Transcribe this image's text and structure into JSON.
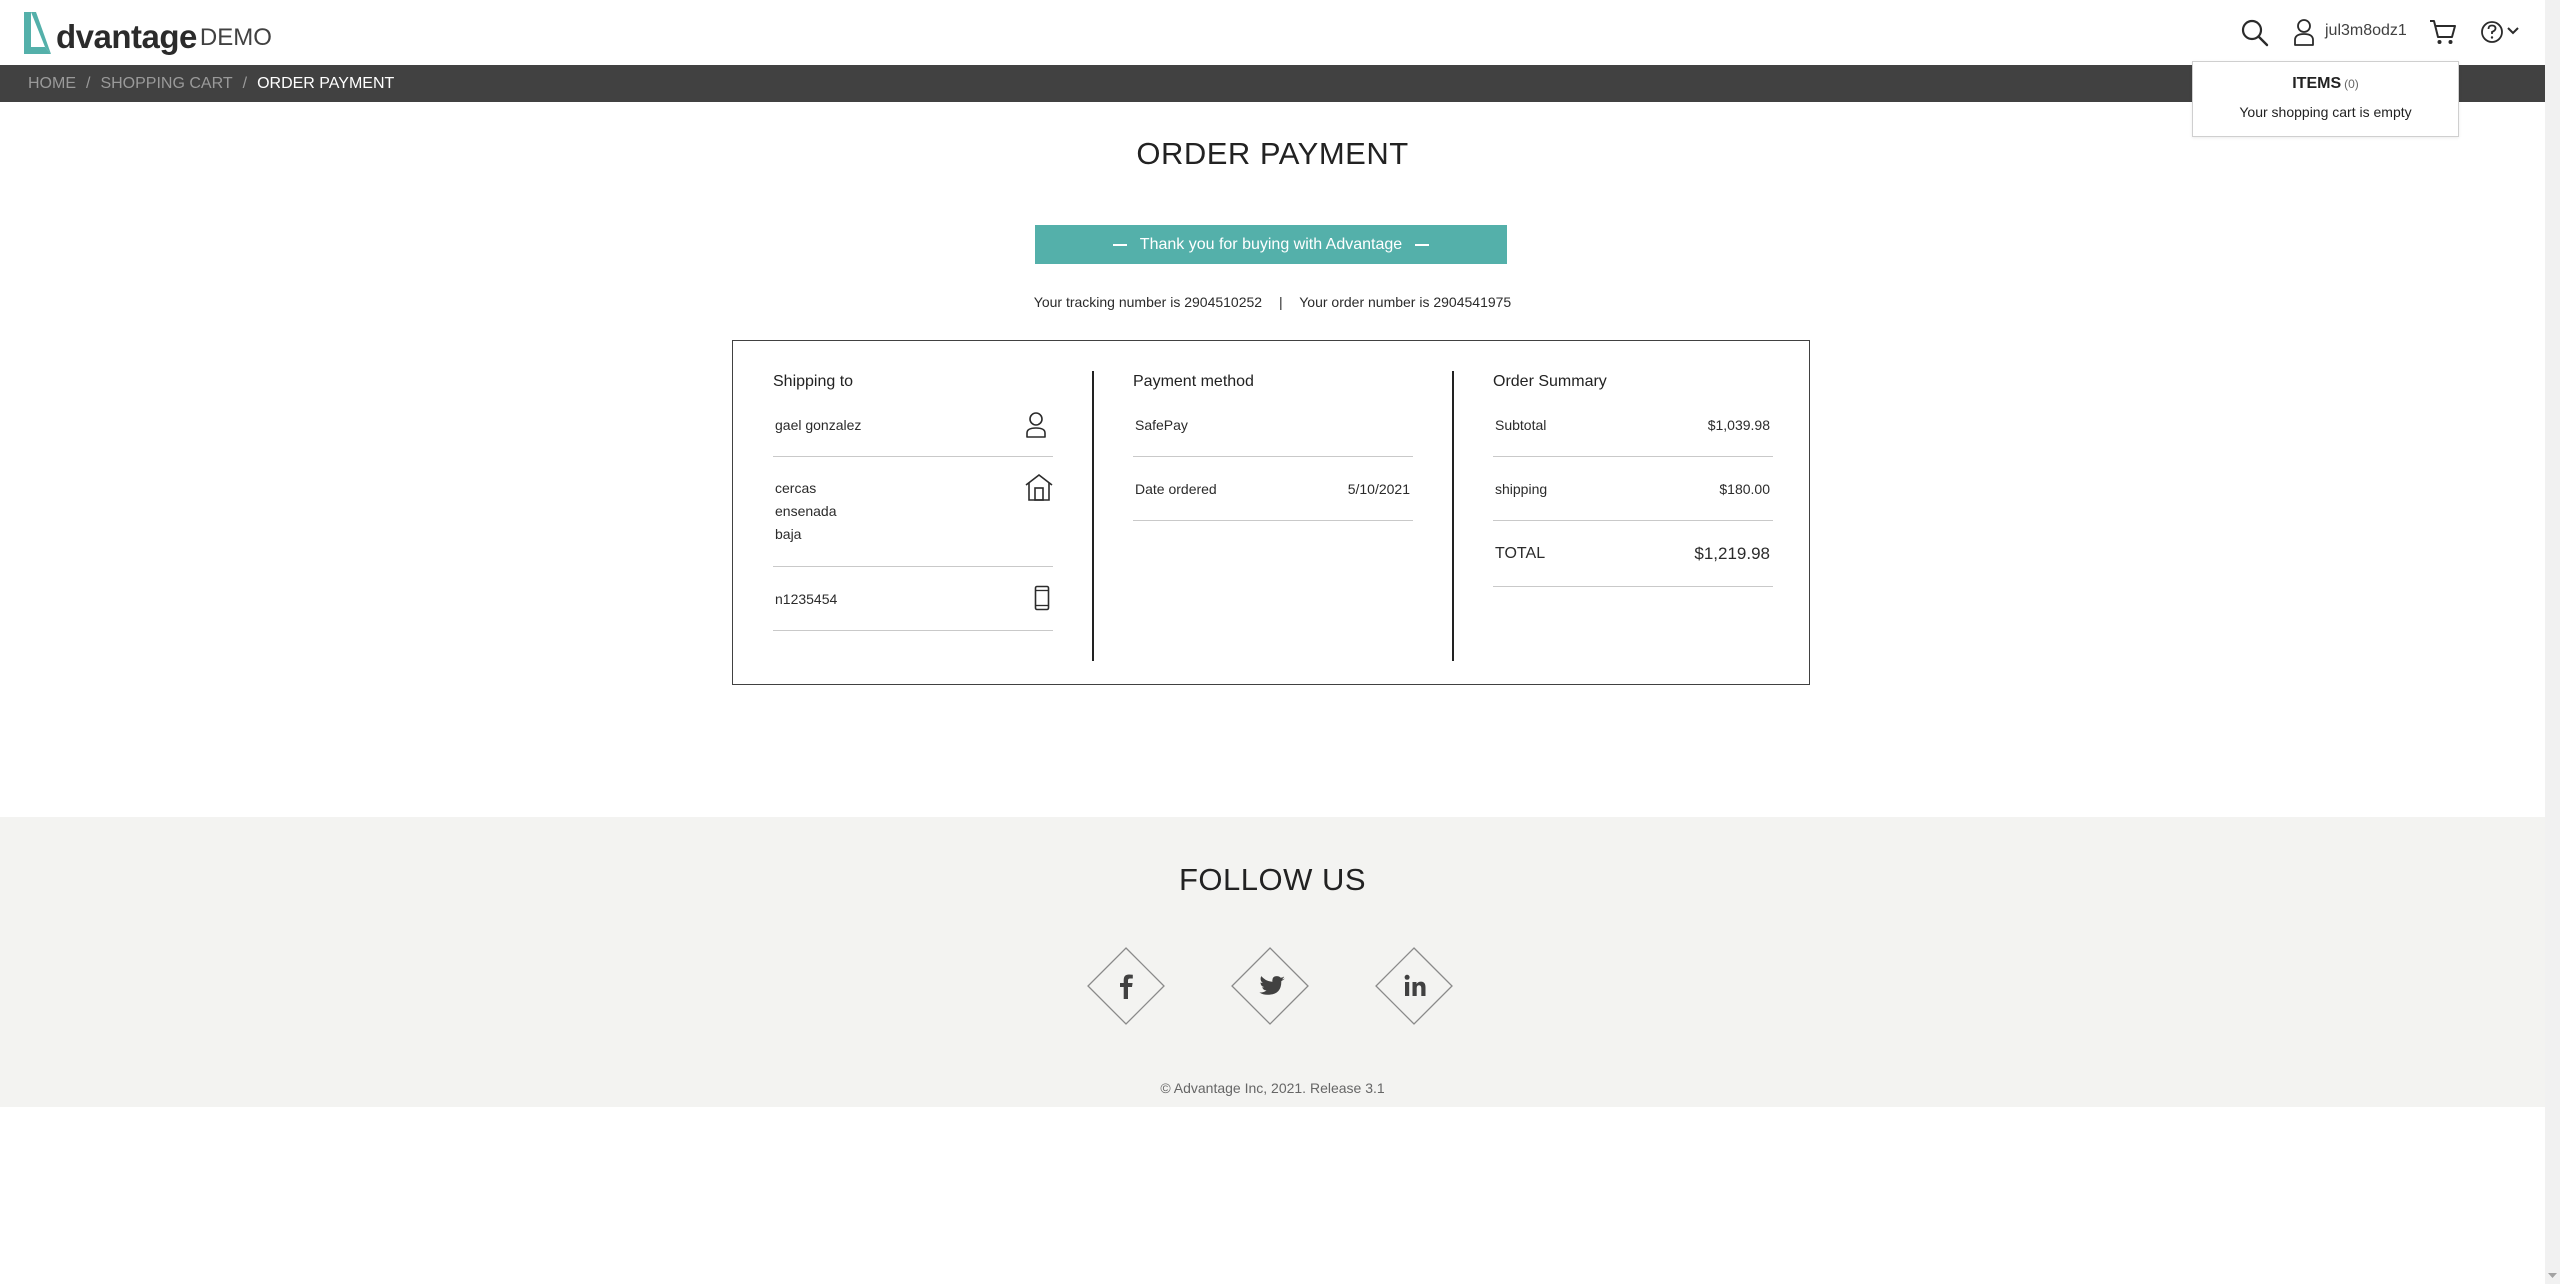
{
  "logo": {
    "word": "dvantage",
    "suffix": "DEMO"
  },
  "header": {
    "username": "jul3m8odz1"
  },
  "breadcrumb": {
    "home": "HOME",
    "cart": "SHOPPING CART",
    "current": "ORDER PAYMENT",
    "separator": "/"
  },
  "cart_dropdown": {
    "title": "ITEMS",
    "count": "(0)",
    "message": "Your shopping cart is empty"
  },
  "main": {
    "title": "ORDER PAYMENT",
    "banner": "Thank you for buying with Advantage",
    "tracking_text": "Your tracking number is 2904510252",
    "separator": "|",
    "order_text": "Your order number is 2904541975"
  },
  "shipping": {
    "title": "Shipping to",
    "name": "gael gonzalez",
    "address": [
      "cercas",
      "ensenada",
      "baja"
    ],
    "phone": "n1235454"
  },
  "payment": {
    "title": "Payment method",
    "method": "SafePay",
    "date_label": "Date ordered",
    "date_value": "5/10/2021"
  },
  "summary": {
    "title": "Order Summary",
    "subtotal_label": "Subtotal",
    "subtotal_value": "$1,039.98",
    "shipping_label": "shipping",
    "shipping_value": "$180.00",
    "total_label": "TOTAL",
    "total_value": "$1,219.98"
  },
  "footer": {
    "follow_title": "FOLLOW US",
    "copyright": "© Advantage Inc, 2021. Release 3.1"
  },
  "colors": {
    "accent": "#54b0aa",
    "crumb_bar": "#414141",
    "footer_bg": "#f3f3f1"
  }
}
